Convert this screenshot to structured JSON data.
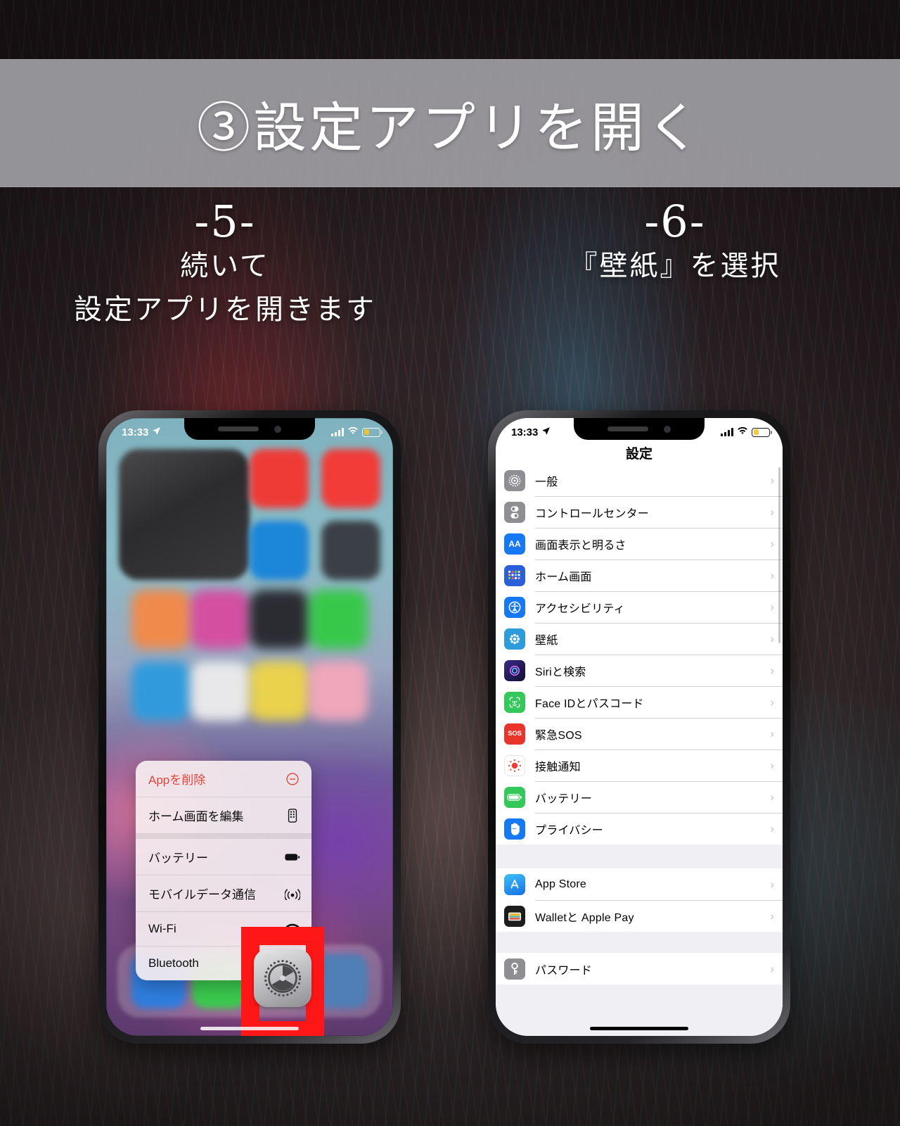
{
  "header": {
    "title": "③設定アプリを開く",
    "band_color": "#9e9da1"
  },
  "captions": {
    "left": {
      "number": "-5-",
      "line1": "続いて",
      "line2": "設定アプリを開きます"
    },
    "right": {
      "number": "-6-",
      "line1": "『壁紙』を選択"
    }
  },
  "accent": {
    "highlight_red": "#ff1616",
    "danger_red": "#e4453a"
  },
  "phone_left": {
    "status": {
      "time": "13:33",
      "location_icon": "location-arrow-icon",
      "signal_icon": "signal-bars-icon",
      "wifi_icon": "wifi-icon",
      "battery_icon": "battery-low-icon"
    },
    "context_menu": {
      "items": [
        {
          "label": "Appを削除",
          "icon": "minus-circle-icon",
          "danger": true
        },
        {
          "label": "ホーム画面を編集",
          "icon": "edit-home-screen-icon",
          "danger": false
        },
        {
          "label": "バッテリー",
          "icon": "battery-icon",
          "danger": false
        },
        {
          "label": "モバイルデータ通信",
          "icon": "cellular-icon",
          "danger": false
        },
        {
          "label": "Wi-Fi",
          "icon": "wifi-icon",
          "danger": false
        },
        {
          "label": "Bluetooth",
          "icon": "bluetooth-icon",
          "danger": false
        }
      ]
    },
    "highlight": {
      "target_icon": "settings-gear-icon"
    }
  },
  "phone_right": {
    "status": {
      "time": "13:33",
      "location_icon": "location-arrow-icon",
      "signal_icon": "signal-bars-icon",
      "wifi_icon": "wifi-icon",
      "battery_icon": "battery-low-icon"
    },
    "nav_title": "設定",
    "groups": [
      {
        "rows": [
          {
            "label": "一般",
            "icon": "gear-icon",
            "icon_color": "#8e8e93"
          },
          {
            "label": "コントロールセンター",
            "icon": "control-center-icon",
            "icon_color": "#8e8e93"
          },
          {
            "label": "画面表示と明るさ",
            "icon": "display-brightness-icon",
            "icon_color": "#1678f2"
          },
          {
            "label": "ホーム画面",
            "icon": "home-screen-icon",
            "icon_color": "#2b5fd9"
          },
          {
            "label": "アクセシビリティ",
            "icon": "accessibility-icon",
            "icon_color": "#1678f2"
          },
          {
            "label": "壁紙",
            "icon": "wallpaper-icon",
            "icon_color": "#2e9bdb"
          },
          {
            "label": "Siriと検索",
            "icon": "siri-icon",
            "icon_color": "#2b2b6e"
          },
          {
            "label": "Face IDとパスコード",
            "icon": "face-id-icon",
            "icon_color": "#34c759"
          },
          {
            "label": "緊急SOS",
            "icon": "sos-icon",
            "icon_color": "#e8342a"
          },
          {
            "label": "接触通知",
            "icon": "exposure-notification-icon",
            "icon_color": "#ffffff"
          },
          {
            "label": "バッテリー",
            "icon": "battery-icon",
            "icon_color": "#34c759"
          },
          {
            "label": "プライバシー",
            "icon": "privacy-hand-icon",
            "icon_color": "#1678f2"
          }
        ]
      },
      {
        "rows": [
          {
            "label": "App Store",
            "icon": "app-store-icon",
            "icon_color": "#1e9af0"
          },
          {
            "label": "Walletと Apple Pay",
            "icon": "wallet-icon",
            "icon_color": "#1c1c1e"
          }
        ]
      },
      {
        "rows": [
          {
            "label": "パスワード",
            "icon": "passwords-key-icon",
            "icon_color": "#8e8e93"
          }
        ]
      }
    ],
    "highlighted_row": {
      "label": "壁紙",
      "icon": "wallpaper-icon"
    },
    "chevron": "›"
  }
}
